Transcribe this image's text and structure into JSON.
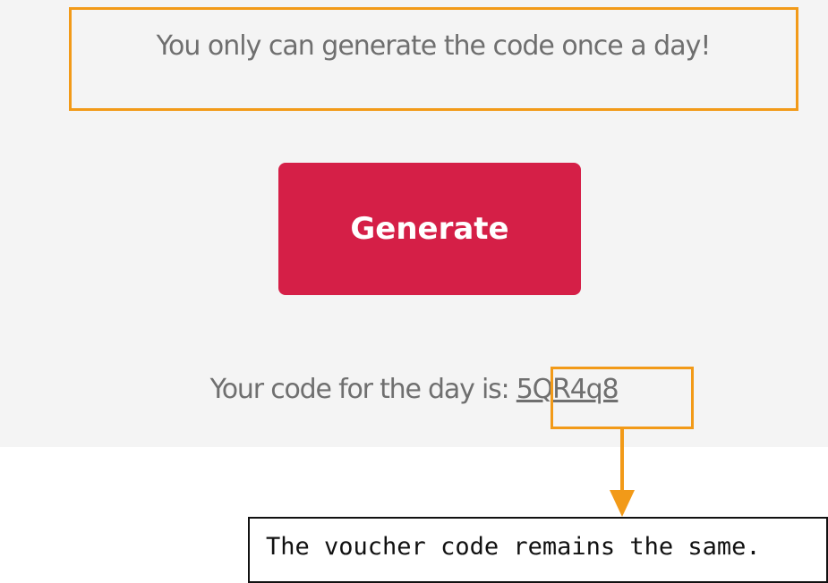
{
  "panel": {
    "message": "You only can generate the code once a day!",
    "generate_label": "Generate",
    "code_prefix": "Your code for the day is: ",
    "code_value": "5QR4q8"
  },
  "annotation": {
    "note": "The voucher code remains the same.",
    "highlight_color": "#f29a18"
  },
  "colors": {
    "button": "#d51f47",
    "panel_bg": "#f4f4f4",
    "text": "#6f6f6f"
  }
}
